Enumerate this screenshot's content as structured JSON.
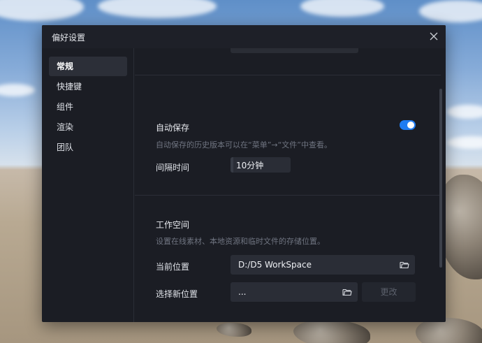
{
  "window": {
    "title": "偏好设置"
  },
  "sidebar": {
    "items": [
      {
        "label": "常规",
        "active": true
      },
      {
        "label": "快捷键",
        "active": false
      },
      {
        "label": "组件",
        "active": false
      },
      {
        "label": "渲染",
        "active": false
      },
      {
        "label": "团队",
        "active": false
      }
    ]
  },
  "autosave": {
    "title": "自动保存",
    "description": "自动保存的历史版本可以在“菜单”→“文件”中查看。",
    "enabled": true,
    "interval_label": "间隔时间",
    "interval_value": "10分钟"
  },
  "workspace": {
    "title": "工作空间",
    "description": "设置在线素材、本地资源和临时文件的存储位置。",
    "current_label": "当前位置",
    "current_value": "D:/D5 WorkSpace",
    "new_label": "选择新位置",
    "new_value": "...",
    "change_button": "更改"
  },
  "colors": {
    "accent": "#1f7cf2",
    "dialog_bg": "#1b1d24",
    "field_bg": "#2a2d36"
  }
}
